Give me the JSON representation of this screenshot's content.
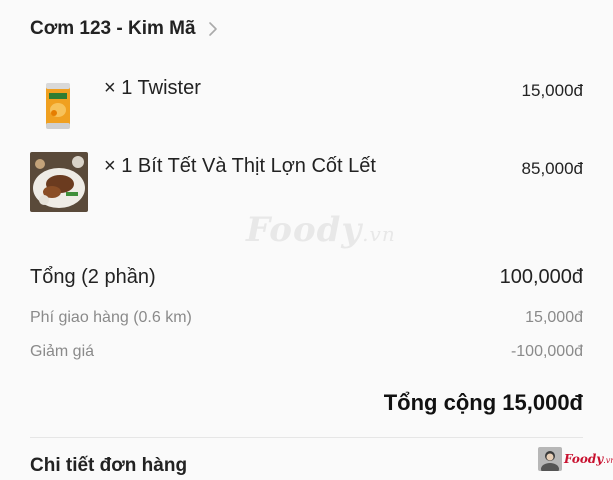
{
  "restaurant": {
    "name": "Cơm 123 - Kim Mã"
  },
  "items": [
    {
      "quantity_label": "× 1 Twister",
      "price": "15,000đ",
      "thumb_icon": "orange-juice-can-image"
    },
    {
      "quantity_label": "× 1 Bít Tết Và Thịt Lợn Cốt Lết",
      "price": "85,000đ",
      "thumb_icon": "steak-plate-image"
    }
  ],
  "watermark": {
    "brand": "Foody",
    "suffix": ".vn"
  },
  "summary": {
    "subtotal_label": "Tổng (2 phần)",
    "subtotal_value": "100,000đ",
    "fee_label": "Phí giao hàng (0.6 km)",
    "fee_value": "15,000đ",
    "discount_label": "Giảm giá",
    "discount_value": "-100,000đ",
    "grand_total": "Tổng cộng 15,000đ"
  },
  "details": {
    "title": "Chi tiết đơn hàng"
  },
  "corner_badge": {
    "brand": "Foody",
    "suffix": ".vn"
  },
  "colors": {
    "text": "#222222",
    "muted": "#8a8a8a",
    "brand": "#c8102e",
    "background": "#fafafa"
  }
}
